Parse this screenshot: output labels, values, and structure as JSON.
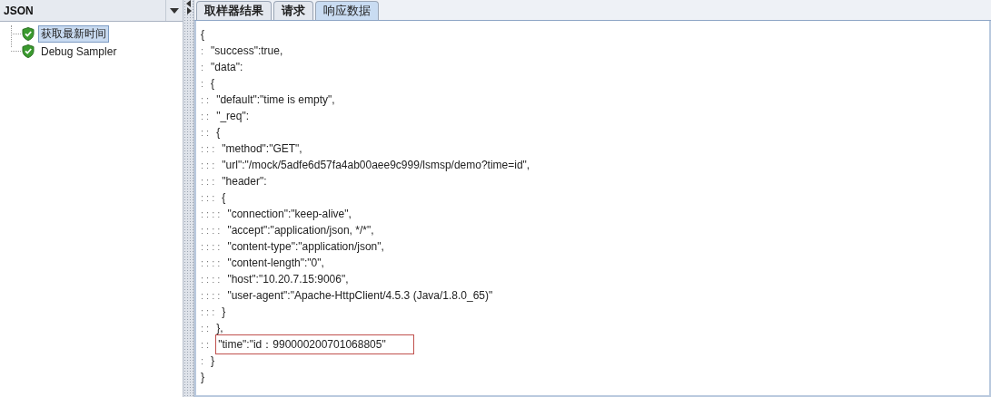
{
  "combo": {
    "value": "JSON"
  },
  "tree": [
    {
      "label": "获取最新时间",
      "selected": true
    },
    {
      "label": "Debug Sampler",
      "selected": false
    }
  ],
  "tabs": [
    {
      "label": "取样器结果",
      "selected": false
    },
    {
      "label": "请求",
      "selected": false
    },
    {
      "label": "响应数据",
      "selected": true
    }
  ],
  "response_lines": [
    {
      "text": "{",
      "boxed": false
    },
    {
      "guides": ":",
      "text": "\"success\":true,",
      "boxed": false
    },
    {
      "guides": ":",
      "text": "\"data\":",
      "boxed": false
    },
    {
      "guides": ":",
      "text": "{",
      "boxed": false
    },
    {
      "guides": ": :",
      "text": "\"default\":\"time is empty\",",
      "boxed": false
    },
    {
      "guides": ": :",
      "text": "\"_req\":",
      "boxed": false
    },
    {
      "guides": ": :",
      "text": "{",
      "boxed": false
    },
    {
      "guides": ": : :",
      "text": "\"method\":\"GET\",",
      "boxed": false
    },
    {
      "guides": ": : :",
      "text": "\"url\":\"/mock/5adfe6d57fa4ab00aee9c999/lsmsp/demo?time=id\",",
      "boxed": false
    },
    {
      "guides": ": : :",
      "text": "\"header\":",
      "boxed": false
    },
    {
      "guides": ": : :",
      "text": "{",
      "boxed": false
    },
    {
      "guides": ": : : :",
      "text": "\"connection\":\"keep-alive\",",
      "boxed": false
    },
    {
      "guides": ": : : :",
      "text": "\"accept\":\"application/json, */*\",",
      "boxed": false
    },
    {
      "guides": ": : : :",
      "text": "\"content-type\":\"application/json\",",
      "boxed": false
    },
    {
      "guides": ": : : :",
      "text": "\"content-length\":\"0\",",
      "boxed": false
    },
    {
      "guides": ": : : :",
      "text": "\"host\":\"10.20.7.15:9006\",",
      "boxed": false
    },
    {
      "guides": ": : : :",
      "text": "\"user-agent\":\"Apache-HttpClient/4.5.3 (Java/1.8.0_65)\"",
      "boxed": false
    },
    {
      "guides": ": : :",
      "text": "}",
      "boxed": false
    },
    {
      "guides": ": :",
      "text": "},",
      "boxed": false
    },
    {
      "guides": ": :",
      "text": "\"time\":\"id：990000200701068805\"",
      "boxed": true
    },
    {
      "guides": ":",
      "text": "}",
      "boxed": false
    },
    {
      "text": "}",
      "boxed": false
    }
  ]
}
